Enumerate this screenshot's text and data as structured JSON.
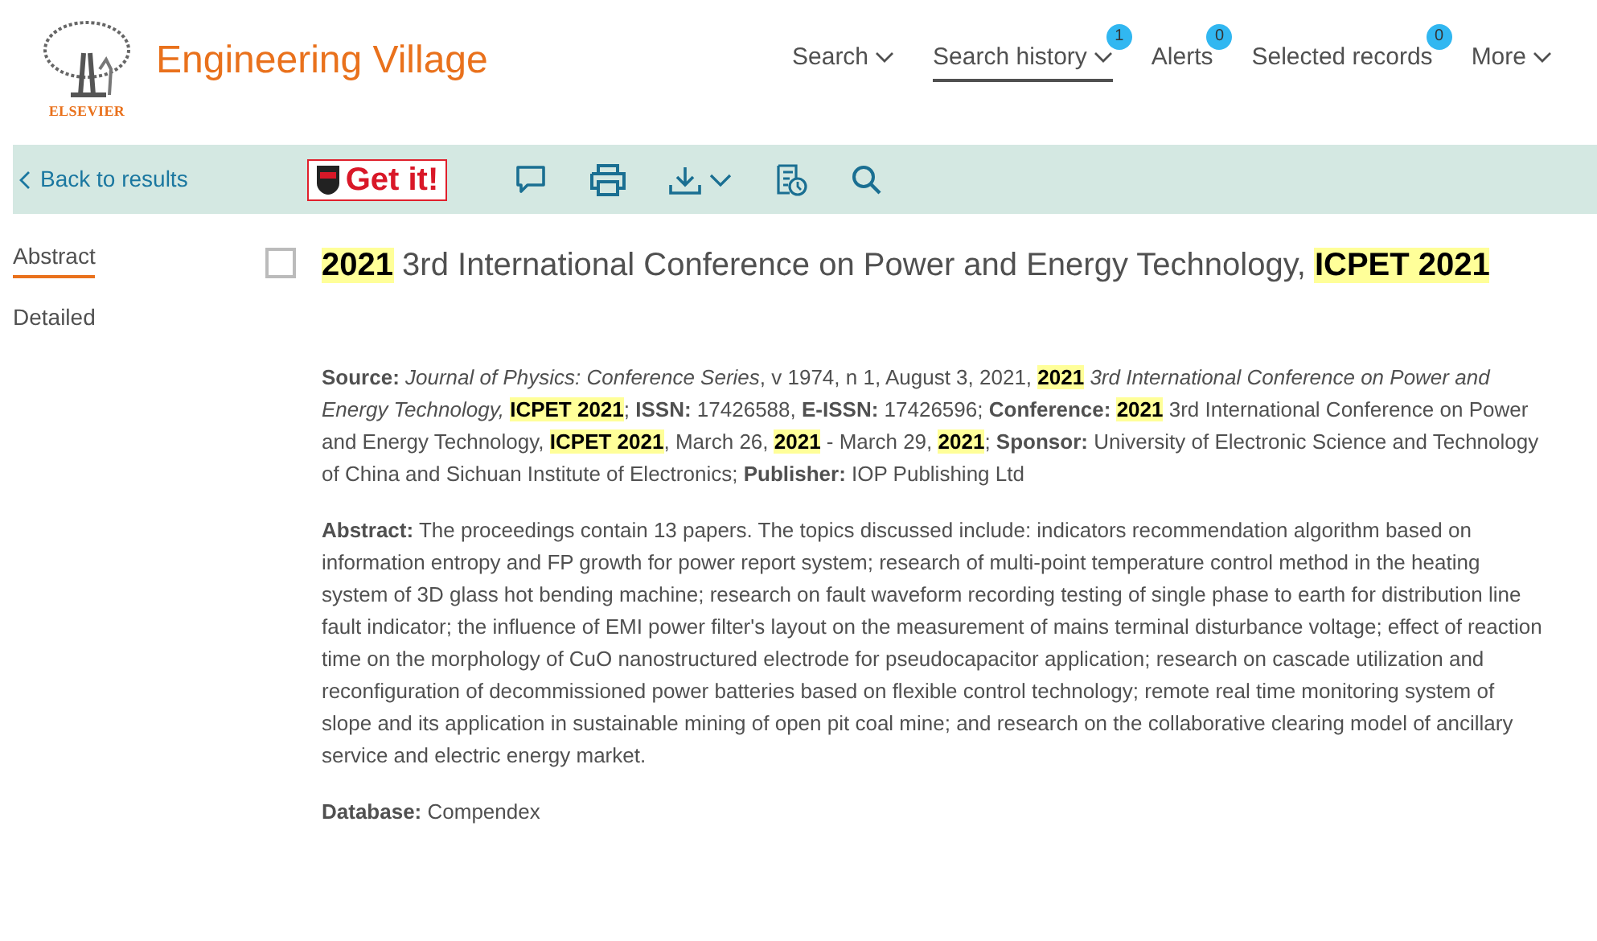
{
  "brand": {
    "publisher": "ELSEVIER",
    "name": "Engineering Village"
  },
  "nav": [
    {
      "label": "Search",
      "dropdown": true,
      "selected": false
    },
    {
      "label": "Search history",
      "dropdown": true,
      "selected": true,
      "badge": "1"
    },
    {
      "label": "Alerts",
      "dropdown": false,
      "selected": false,
      "badge": "0"
    },
    {
      "label": "Selected records",
      "dropdown": false,
      "selected": false,
      "badge": "0"
    },
    {
      "label": "More",
      "dropdown": true,
      "selected": false
    }
  ],
  "toolbar": {
    "back": "Back to results",
    "get_it": "Get it!"
  },
  "sidebar": {
    "items": [
      {
        "label": "Abstract",
        "selected": true
      },
      {
        "label": "Detailed",
        "selected": false
      }
    ]
  },
  "record": {
    "checked": false,
    "title": [
      {
        "kind": "highlight",
        "text": "2021"
      },
      {
        "kind": "plain",
        "text": " 3rd International Conference on Power and Energy Technology, "
      },
      {
        "kind": "highlight",
        "text": "ICPET 2021"
      }
    ],
    "source": [
      {
        "kind": "label",
        "text": "Source:"
      },
      {
        "kind": "italic",
        "text": " Journal of Physics: Conference Series"
      },
      {
        "kind": "plain",
        "text": ", v 1974, n 1, August 3, 2021, "
      },
      {
        "kind": "highlight",
        "text": "2021"
      },
      {
        "kind": "italic",
        "text": " 3rd International Conference on Power and Energy Technology, "
      },
      {
        "kind": "highlight",
        "text": "ICPET 2021"
      },
      {
        "kind": "plain",
        "text": ";  "
      },
      {
        "kind": "label",
        "text": "ISSN:"
      },
      {
        "kind": "plain",
        "text": " 17426588,  "
      },
      {
        "kind": "label",
        "text": "E-ISSN:"
      },
      {
        "kind": "plain",
        "text": " 17426596; "
      },
      {
        "kind": "label",
        "text": "Conference: "
      },
      {
        "kind": "highlight",
        "text": "2021"
      },
      {
        "kind": "plain",
        "text": " 3rd International Conference on Power and Energy Technology, "
      },
      {
        "kind": "highlight",
        "text": "ICPET 2021"
      },
      {
        "kind": "plain",
        "text": ", March 26, "
      },
      {
        "kind": "highlight",
        "text": "2021"
      },
      {
        "kind": "plain",
        "text": " - March 29, "
      },
      {
        "kind": "highlight",
        "text": "2021"
      },
      {
        "kind": "plain",
        "text": "; "
      },
      {
        "kind": "label",
        "text": "Sponsor:"
      },
      {
        "kind": "plain",
        "text": " University of Electronic Science and Technology of China and Sichuan Institute of Electronics; "
      },
      {
        "kind": "label",
        "text": "Publisher:"
      },
      {
        "kind": "plain",
        "text": " IOP Publishing Ltd"
      }
    ],
    "abstract": "**Abstract:** The proceedings contain 13 papers. The topics discussed include: indicators recommendation algorithm based on information entropy and FP growth for power report system; research of multi-point temperature control method in the heating system of 3D glass hot bending machine; research on fault waveform recording testing of single phase to earth for distribution line fault indicator; the influence of EMI power filter's layout on the measurement of mains terminal disturbance voltage; effect of reaction time on the morphology of CuO nanostructured electrode for pseudocapacitor application; research on cascade utilization and reconfiguration of decommissioned power batteries based on flexible control technology; remote real time monitoring system of slope and its application in sustainable mining of open pit coal mine; and research on the collaborative clearing model of ancillary service and electric energy market.",
    "database": "**Database:** Compendex"
  }
}
